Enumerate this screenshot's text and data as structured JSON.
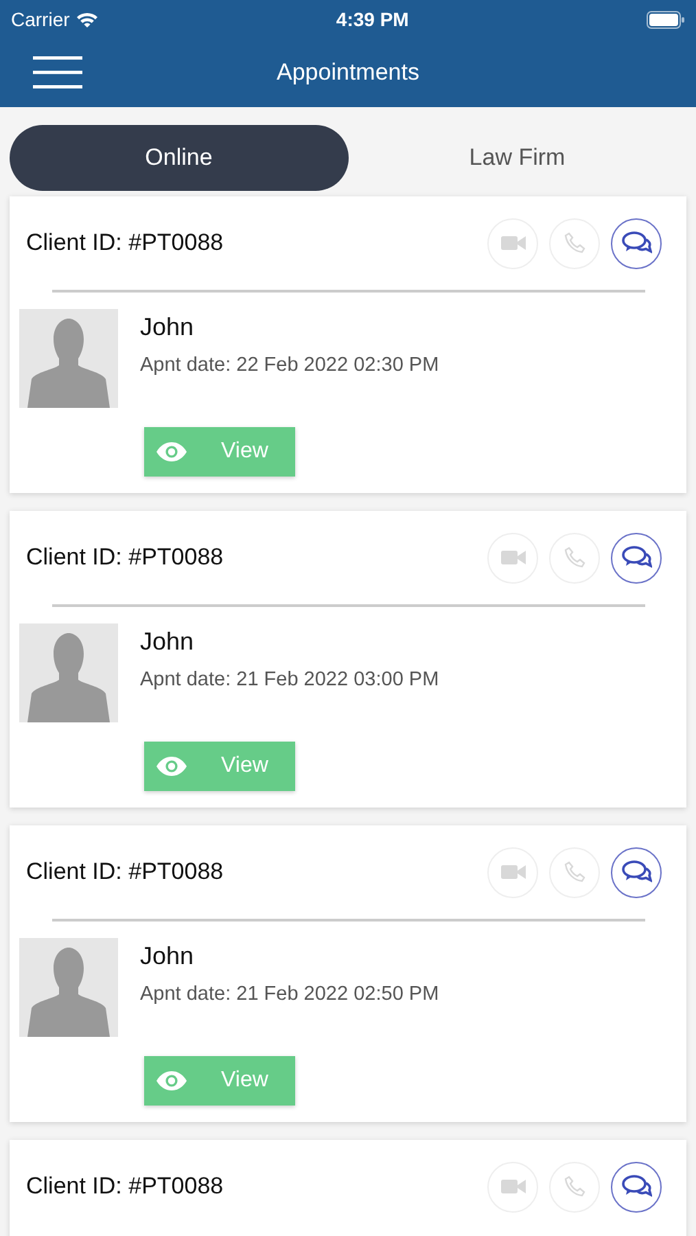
{
  "status_bar": {
    "carrier": "Carrier",
    "time": "4:39 PM"
  },
  "nav_bar": {
    "title": "Appointments"
  },
  "tabs": [
    {
      "label": "Online",
      "selected": true
    },
    {
      "label": "Law Firm",
      "selected": false
    }
  ],
  "appointments": [
    {
      "client_id": "Client ID: #PT0088",
      "actions": [
        {
          "kind": "video",
          "disabled": true
        },
        {
          "kind": "phone",
          "disabled": true
        },
        {
          "kind": "chat",
          "disabled": false
        }
      ],
      "name": "John",
      "date": "Apnt date: 22 Feb 2022 02:30 PM",
      "button": "View"
    },
    {
      "client_id": "Client ID: #PT0088",
      "actions": [
        {
          "kind": "video",
          "disabled": true
        },
        {
          "kind": "phone",
          "disabled": true
        },
        {
          "kind": "chat",
          "disabled": false
        }
      ],
      "name": "John",
      "date": "Apnt date: 21 Feb 2022 03:00 PM",
      "button": "View"
    },
    {
      "client_id": "Client ID: #PT0088",
      "actions": [
        {
          "kind": "video",
          "disabled": true
        },
        {
          "kind": "phone",
          "disabled": true
        },
        {
          "kind": "chat",
          "disabled": false
        }
      ],
      "name": "John",
      "date": "Apnt date: 21 Feb 2022 02:50 PM",
      "button": "View"
    },
    {
      "client_id": "Client ID: #PT0088",
      "actions": [
        {
          "kind": "video",
          "disabled": true
        },
        {
          "kind": "phone",
          "disabled": true
        },
        {
          "kind": "chat",
          "disabled": false
        }
      ]
    }
  ]
}
